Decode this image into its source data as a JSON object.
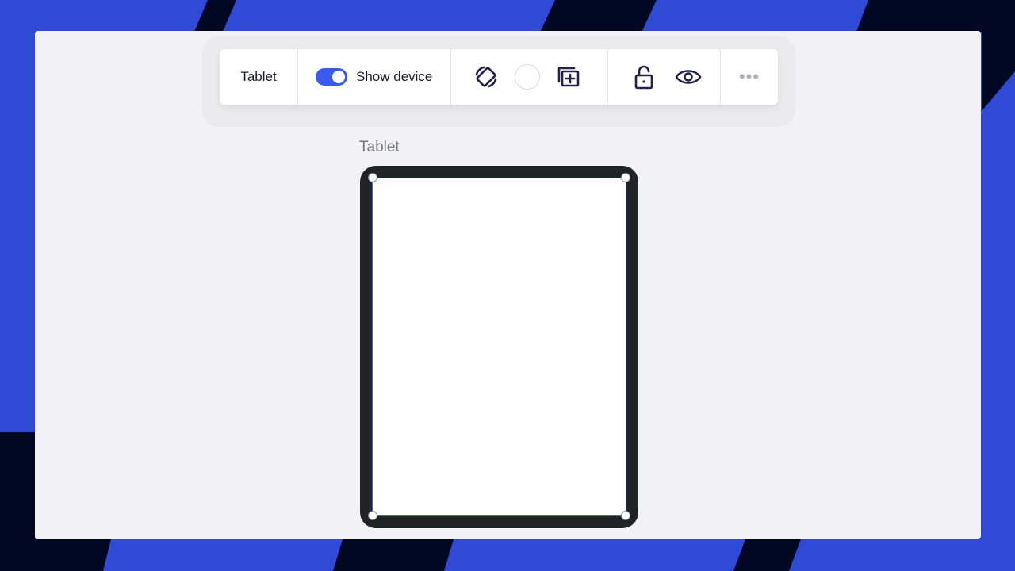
{
  "toolbar": {
    "frame_name": "Tablet",
    "show_device_label": "Show device",
    "show_device_on": true,
    "more_label": "•••"
  },
  "icons": {
    "rotate": "rotate-device-icon",
    "fill_color": "fill-color-swatch",
    "add_frame": "add-frame-icon",
    "lock": "unlock-icon",
    "visibility": "eye-icon",
    "more": "more-options-icon"
  },
  "frame": {
    "label": "Tablet"
  },
  "colors": {
    "accent": "#3a5bf0",
    "background": "#2f4ad6",
    "stripe": "#020724",
    "canvas": "#f2f2f4",
    "device_bezel": "#222327",
    "icon": "#23234a"
  }
}
